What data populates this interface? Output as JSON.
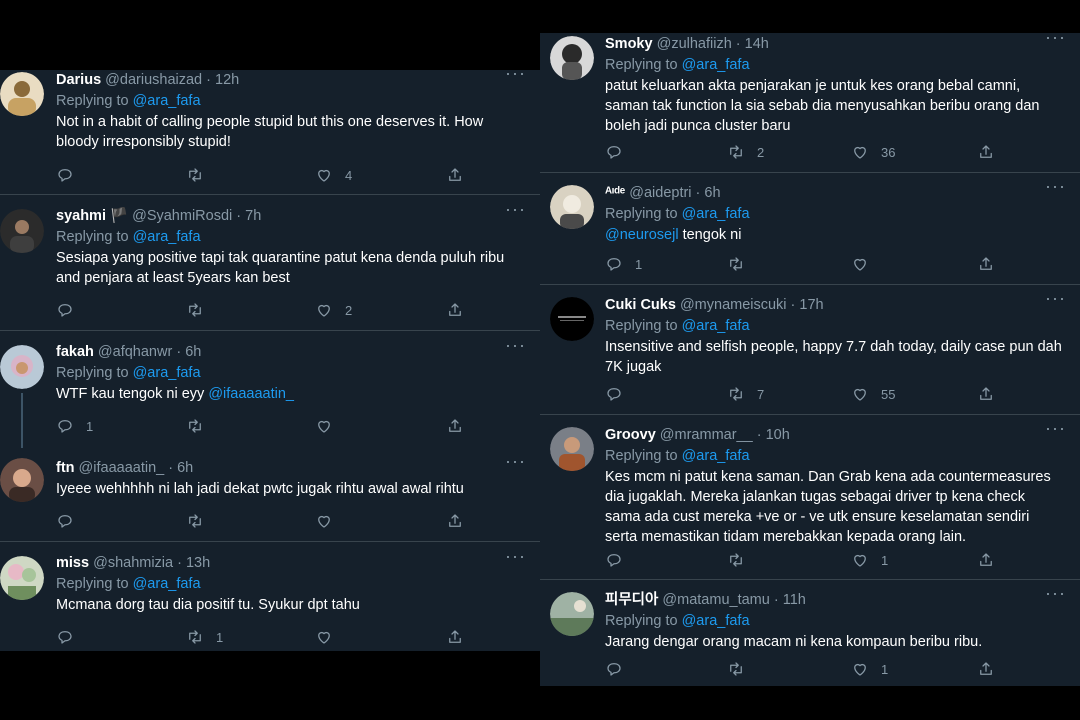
{
  "left_tweets": [
    {
      "name": "Darius",
      "handle": "@dariushaizad",
      "time": "12h",
      "replying_to": "Replying to",
      "mention": "@ara_fafa",
      "text": "Not in a habit of calling people stupid but this one deserves it. How bloody irresponsibly stupid!",
      "replies": "",
      "retweets": "",
      "likes": "4"
    },
    {
      "name": "syahmi 🏴",
      "handle": "@SyahmiRosdi",
      "time": "7h",
      "replying_to": "Replying to",
      "mention": "@ara_fafa",
      "text": "Sesiapa yang positive tapi tak quarantine patut kena denda puluh ribu and penjara at least 5years kan best",
      "replies": "",
      "retweets": "",
      "likes": "2"
    },
    {
      "name": "fakah",
      "handle": "@afqhanwr",
      "time": "6h",
      "replying_to": "Replying to",
      "mention": "@ara_fafa",
      "text": "WTF kau tengok ni eyy",
      "text_mention": "@ifaaaaatin_",
      "replies": "1",
      "retweets": "",
      "likes": ""
    },
    {
      "name": "ftn",
      "handle": "@ifaaaaatin_",
      "time": "6h",
      "text": "Iyeee wehhhhh ni lah jadi dekat pwtc jugak rihtu awal awal rihtu",
      "replies": "",
      "retweets": "",
      "likes": ""
    },
    {
      "name": "miss",
      "handle": "@shahmizia",
      "time": "13h",
      "replying_to": "Replying to",
      "mention": "@ara_fafa",
      "text": "Mcmana dorg tau dia positif tu. Syukur dpt tahu",
      "replies": "",
      "retweets": "1",
      "likes": ""
    }
  ],
  "right_tweets": [
    {
      "name": "Smoky",
      "handle": "@zulhafiizh",
      "time": "14h",
      "replying_to": "Replying to",
      "mention": "@ara_fafa",
      "text": "patut keluarkan akta penjarakan je untuk kes orang bebal camni, saman tak function la sia sebab dia menyusahkan beribu orang dan boleh jadi punca cluster baru",
      "replies": "",
      "retweets": "2",
      "likes": "36"
    },
    {
      "name": "ᴬᶦᵈᵉ",
      "handle": "@aideptri",
      "time": "6h",
      "replying_to": "Replying to",
      "mention": "@ara_fafa",
      "text_mention": "@neurosejl",
      "text": "tengok ni",
      "replies": "1",
      "retweets": "",
      "likes": ""
    },
    {
      "name": "Cuki Cuks",
      "handle": "@mynameiscuki",
      "time": "17h",
      "replying_to": "Replying to",
      "mention": "@ara_fafa",
      "text": "Insensitive and selfish people,  happy 7.7 dah today,  daily case pun dah 7K jugak",
      "replies": "",
      "retweets": "7",
      "likes": "55"
    },
    {
      "name": "Groovy",
      "handle": "@mrammar__",
      "time": "10h",
      "replying_to": "Replying to",
      "mention": "@ara_fafa",
      "text": "Kes mcm ni patut kena saman. Dan Grab kena ada countermeasures dia jugaklah. Mereka jalankan tugas sebagai driver tp kena check sama ada cust mereka +ve or - ve utk ensure keselamatan sendiri serta memastikan tidam merebakkan kepada orang lain.",
      "replies": "",
      "retweets": "",
      "likes": "1"
    },
    {
      "name": "피무디아",
      "handle": "@matamu_tamu",
      "time": "11h",
      "replying_to": "Replying to",
      "mention": "@ara_fafa",
      "text": "Jarang dengar orang macam ni kena kompaun beribu ribu.",
      "replies": "",
      "retweets": "",
      "likes": "1"
    }
  ],
  "colors": {
    "background": "#15202b",
    "text": "#ffffff",
    "muted": "#8899a6",
    "accent": "#1d9bf0",
    "divider": "#38444d"
  },
  "icons": {
    "reply": "reply-icon",
    "retweet": "retweet-icon",
    "like": "heart-icon",
    "share": "share-icon",
    "more": "more-icon"
  }
}
